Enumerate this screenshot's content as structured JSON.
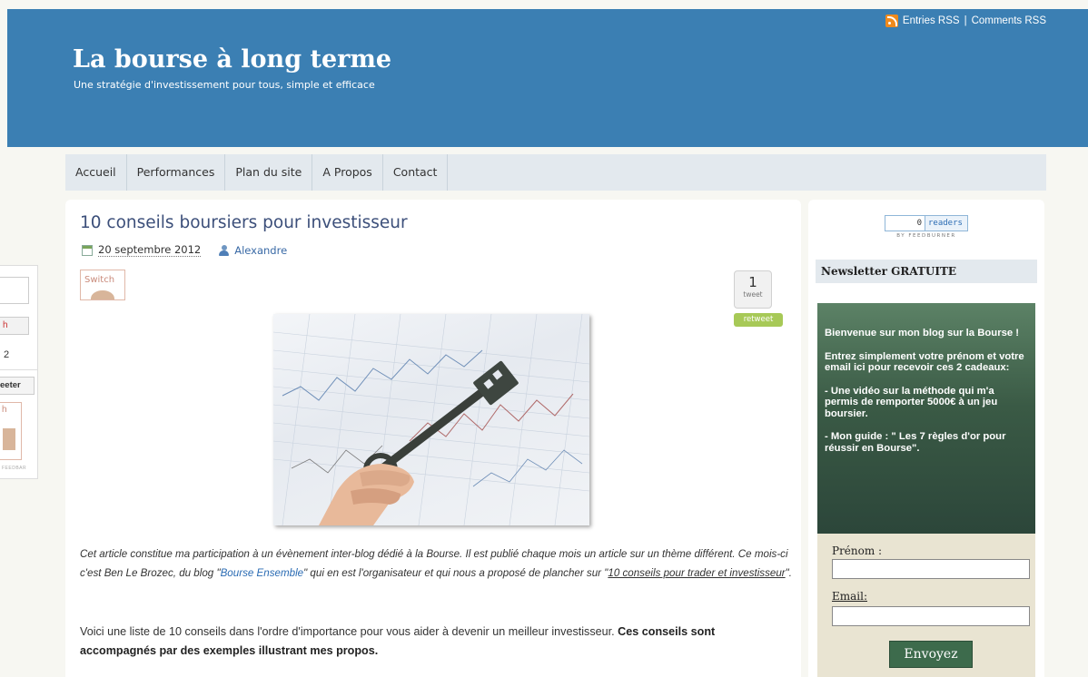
{
  "header": {
    "rss_entries": "Entries RSS",
    "rss_separator": " | ",
    "rss_comments": "Comments RSS",
    "site_title": "La bourse à long terme",
    "tagline": "Une stratégie d'investissement pour tous, simple et efficace"
  },
  "nav": {
    "items": [
      {
        "label": "Accueil"
      },
      {
        "label": "Performances"
      },
      {
        "label": "Plan du site"
      },
      {
        "label": "A Propos"
      },
      {
        "label": "Contact"
      }
    ]
  },
  "post": {
    "title": "10 conseils boursiers pour investisseur",
    "date": "20 septembre 2012",
    "author": "Alexandre",
    "switch_label": "Switch",
    "tweet_count": "1",
    "tweet_label": "tweet",
    "retweet_label": "retweet",
    "image_icon": "key-on-stock-chart-photo",
    "para1": {
      "text_a": "Cet article constitue ma participation à un évènement inter-blog dédié à la Bourse. Il est publié chaque mois un article sur un thème différent. Ce mois-ci c'est Ben Le Brozec, du blog \"",
      "link1": "Bourse Ensemble",
      "text_b": "\" qui en est l'organisateur et qui nous a proposé de plancher sur \"",
      "link2": "10 conseils pour trader et investisseur",
      "text_c": "\"."
    },
    "para2": {
      "text_a": "Voici une liste de 10 conseils dans l'ordre d'importance pour vous aider à devenir un meilleur investisseur. ",
      "bold": "Ces conseils sont accompagnés par des exemples illustrant mes propos."
    }
  },
  "sidebar": {
    "readers_count": "0",
    "readers_label": "readers",
    "feedburner": "BY FEEDBURNER",
    "newsletter_title": "Newsletter GRATUITE",
    "welcome": "Bienvenue sur mon blog sur la Bourse !",
    "instructions": "Entrez simplement votre prénom et votre email ici pour recevoir ces 2 cadeaux:",
    "gift1": "- Une vidéo sur la méthode qui m'a permis de remporter 5000€ à un jeu boursier.",
    "gift2": "- Mon guide : \" Les 7 règles d'or pour réussir en Bourse\".",
    "prenom_label": "Prénom :",
    "email_label": "Email:",
    "submit_label": "Envoyez"
  },
  "widget": {
    "num": "2",
    "tweeter": "eeter",
    "photo_letter": "h",
    "btn_letter": "h",
    "foot": "FEEDBAR"
  },
  "colors": {
    "header_bg": "#3b7fb3",
    "nav_bg": "#e3e9ee",
    "newsletter_green": "#3a5a45",
    "link_blue": "#2a6bb3"
  }
}
